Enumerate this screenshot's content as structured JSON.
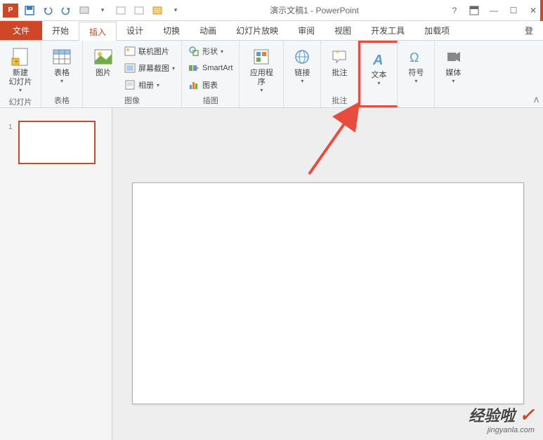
{
  "app": {
    "icon_text": "P",
    "title": "演示文稿1 - PowerPoint"
  },
  "qat": {
    "save": "💾",
    "undo": "↶",
    "redo": "↷",
    "mode": "▢",
    "open_b1": "▢",
    "open_b2": "▢",
    "open_b3": "▢"
  },
  "title_controls": {
    "help": "?",
    "ribbon_opts": "⬒",
    "minimize": "—",
    "restore": "☐",
    "close": "✕"
  },
  "tabs": {
    "file": "文件",
    "home": "开始",
    "insert": "插入",
    "design": "设计",
    "transitions": "切换",
    "animations": "动画",
    "slideshow": "幻灯片放映",
    "review": "审阅",
    "view": "视图",
    "developer": "开发工具",
    "addins": "加载项",
    "signin": "登"
  },
  "ribbon": {
    "new_slide": "新建\n幻灯片",
    "slides_group": "幻灯片",
    "table": "表格",
    "tables_group": "表格",
    "pictures": "图片",
    "online_pictures": "联机图片",
    "screenshot": "屏幕截图",
    "photo_album": "相册",
    "images_group": "图像",
    "shapes": "形状",
    "smartart": "SmartArt",
    "chart": "图表",
    "illustrations_group": "插图",
    "apps": "应用程\n序",
    "links": "链接",
    "comment": "批注",
    "comments_group": "批注",
    "text": "文本",
    "symbols": "符号",
    "media": "媒体"
  },
  "sidebar": {
    "thumb_num": "1"
  },
  "watermark": {
    "main": "经验啦",
    "check": "✓",
    "sub": "jingyanla.com"
  }
}
